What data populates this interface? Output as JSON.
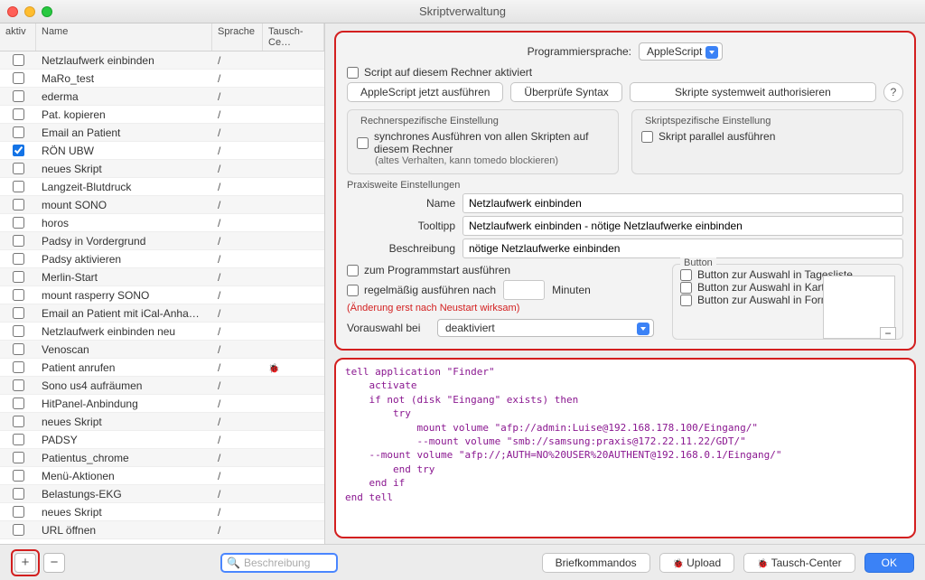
{
  "window": {
    "title": "Skriptverwaltung"
  },
  "table": {
    "headers": {
      "aktiv": "aktiv",
      "name": "Name",
      "sprache": "Sprache",
      "tausch": "Tausch-Ce…"
    },
    "rows": [
      {
        "aktiv": false,
        "name": "Netzlaufwerk einbinden",
        "sprache": "/",
        "tausch": ""
      },
      {
        "aktiv": false,
        "name": "MaRo_test",
        "sprache": "/",
        "tausch": ""
      },
      {
        "aktiv": false,
        "name": "ederma",
        "sprache": "/",
        "tausch": ""
      },
      {
        "aktiv": false,
        "name": "Pat. kopieren",
        "sprache": "/",
        "tausch": ""
      },
      {
        "aktiv": false,
        "name": "Email an Patient",
        "sprache": "/",
        "tausch": ""
      },
      {
        "aktiv": true,
        "name": "RÖN UBW",
        "sprache": "/",
        "tausch": ""
      },
      {
        "aktiv": false,
        "name": "neues Skript",
        "sprache": "/",
        "tausch": ""
      },
      {
        "aktiv": false,
        "name": "Langzeit-Blutdruck",
        "sprache": "/",
        "tausch": ""
      },
      {
        "aktiv": false,
        "name": "mount SONO",
        "sprache": "/",
        "tausch": ""
      },
      {
        "aktiv": false,
        "name": "horos",
        "sprache": "/",
        "tausch": ""
      },
      {
        "aktiv": false,
        "name": "Padsy in Vordergrund",
        "sprache": "/",
        "tausch": ""
      },
      {
        "aktiv": false,
        "name": "Padsy aktivieren",
        "sprache": "/",
        "tausch": ""
      },
      {
        "aktiv": false,
        "name": "Merlin-Start",
        "sprache": "/",
        "tausch": ""
      },
      {
        "aktiv": false,
        "name": "mount rasperry SONO",
        "sprache": "/",
        "tausch": ""
      },
      {
        "aktiv": false,
        "name": "Email an Patient mit iCal-Anha…",
        "sprache": "/",
        "tausch": ""
      },
      {
        "aktiv": false,
        "name": "Netzlaufwerk einbinden neu",
        "sprache": "/",
        "tausch": ""
      },
      {
        "aktiv": false,
        "name": "Venoscan",
        "sprache": "/",
        "tausch": ""
      },
      {
        "aktiv": false,
        "name": "Patient anrufen",
        "sprache": "/",
        "tausch": "🐞"
      },
      {
        "aktiv": false,
        "name": "Sono us4 aufräumen",
        "sprache": "/",
        "tausch": ""
      },
      {
        "aktiv": false,
        "name": "HitPanel-Anbindung",
        "sprache": "/",
        "tausch": ""
      },
      {
        "aktiv": false,
        "name": "neues Skript",
        "sprache": "/",
        "tausch": ""
      },
      {
        "aktiv": false,
        "name": "PADSY",
        "sprache": "/",
        "tausch": ""
      },
      {
        "aktiv": false,
        "name": "Patientus_chrome",
        "sprache": "/",
        "tausch": ""
      },
      {
        "aktiv": false,
        "name": "Menü-Aktionen",
        "sprache": "/",
        "tausch": ""
      },
      {
        "aktiv": false,
        "name": "Belastungs-EKG",
        "sprache": "/",
        "tausch": ""
      },
      {
        "aktiv": false,
        "name": "neues Skript",
        "sprache": "/",
        "tausch": ""
      },
      {
        "aktiv": false,
        "name": "URL öffnen",
        "sprache": "/",
        "tausch": ""
      }
    ]
  },
  "form": {
    "lang_label": "Programmiersprache:",
    "lang_value": "AppleScript",
    "active_label": "Script auf diesem Rechner aktiviert",
    "btn_run": "AppleScript jetzt ausführen",
    "btn_syntax": "Überprüfe Syntax",
    "btn_auth": "Skripte systemweit authorisieren",
    "machine_legend": "Rechnerspezifische Einstellung",
    "sync_label": "synchrones Ausführen von allen Skripten auf diesem Rechner",
    "sync_sub": "(altes Verhalten, kann tomedo blockieren)",
    "specific_legend": "Skriptspezifische Einstellung",
    "parallel_label": "Skript parallel ausführen",
    "praxis_legend": "Praxisweite Einstellungen",
    "name_label": "Name",
    "name_value": "Netzlaufwerk einbinden",
    "tooltip_label": "Tooltipp",
    "tooltip_value": "Netzlaufwerk einbinden - nötige Netzlaufwerke einbinden",
    "desc_label": "Beschreibung",
    "desc_value": "nötige Netzlaufwerke einbinden",
    "startup_label": "zum Programmstart ausführen",
    "regular_label": "regelmäßig ausführen nach",
    "minutes_label": "Minuten",
    "restart_note": "(Änderung erst nach Neustart wirksam)",
    "preselect_label": "Vorauswahl bei",
    "preselect_value": "deaktiviert",
    "button_legend": "Button",
    "btn_tag_label": "Button zur Auswahl in Tagesliste",
    "btn_kartei_label": "Button zur Auswahl in Kartei",
    "btn_form_label": "Button zur Auswahl in Formular"
  },
  "code": "tell application \"Finder\"\n    activate\n    if not (disk \"Eingang\" exists) then\n        try\n            mount volume \"afp://admin:Luise@192.168.178.100/Eingang/\"\n            --mount volume \"smb://samsung:praxis@172.22.11.22/GDT/\"\n    --mount volume \"afp://;AUTH=NO%20USER%20AUTHENT@192.168.0.1/Eingang/\"\n        end try\n    end if\nend tell",
  "footer": {
    "search_placeholder": "Beschreibung",
    "brief": "Briefkommandos",
    "upload": "Upload",
    "tausch": "Tausch-Center",
    "ok": "OK"
  }
}
